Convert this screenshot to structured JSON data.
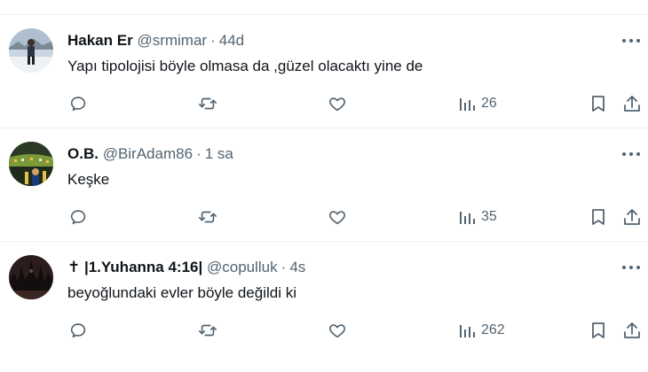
{
  "tweets": [
    {
      "name": "Hakan Er",
      "handle": "@srmimar",
      "separator": "·",
      "time": "44d",
      "text": "Yapı tipolojisi böyle olmasa da ,güzel olacaktı yine de",
      "views": "26",
      "avatar": "person-in-snow"
    },
    {
      "name": "O.B.",
      "handle": "@BirAdam86",
      "separator": "·",
      "time": "1 sa",
      "text": "Keşke",
      "views": "35",
      "avatar": "stadium-crowd"
    },
    {
      "name": "✝ |1.Yuhanna 4:16|",
      "handle": "@copulluk",
      "separator": "·",
      "time": "4s",
      "text": "beyoğlundaki evler böyle değildi ki",
      "views": "262",
      "avatar": "dark-cathedral"
    }
  ],
  "icons": {
    "more": "more-dots-icon",
    "reply": "reply-icon",
    "retweet": "retweet-icon",
    "like": "like-icon",
    "views": "views-icon",
    "bookmark": "bookmark-icon",
    "share": "share-icon"
  },
  "colors": {
    "text": "#0f1419",
    "muted": "#536471",
    "divider": "#eff3f4"
  }
}
